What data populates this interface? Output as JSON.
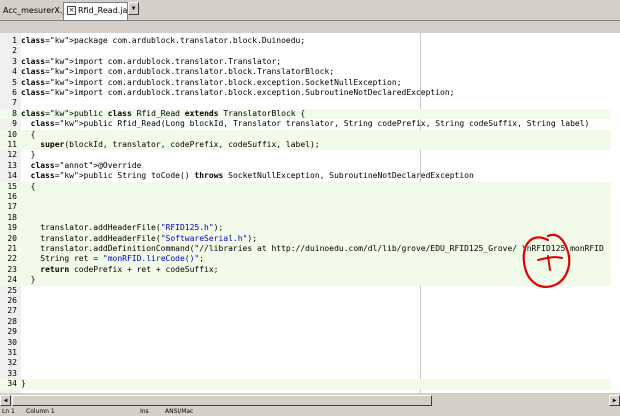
{
  "tabs": [
    {
      "label": "Acc_mesurerX.java",
      "active": false
    },
    {
      "label": "Rfid_Read.java",
      "active": true
    }
  ],
  "tab_dropdown_icon": "chevron-down-icon",
  "colors": {
    "highlight_line": "#f2fbe9",
    "string": "#0000cc",
    "annotation_scribble": "#e00000"
  },
  "lines": [
    {
      "n": "1",
      "text": "package com.ardublock.translator.block.Duinoedu;",
      "hl": false
    },
    {
      "n": "2",
      "text": "",
      "hl": false
    },
    {
      "n": "3",
      "text": "import com.ardublock.translator.Translator;",
      "hl": false
    },
    {
      "n": "4",
      "text": "import com.ardublock.translator.block.TranslatorBlock;",
      "hl": false
    },
    {
      "n": "5",
      "text": "import com.ardublock.translator.block.exception.SocketNullException;",
      "hl": false
    },
    {
      "n": "6",
      "text": "import com.ardublock.translator.block.exception.SubroutineNotDeclaredException;",
      "hl": false
    },
    {
      "n": "7",
      "text": "",
      "hl": false
    },
    {
      "n": "8",
      "text": "public class Rfid_Read extends TranslatorBlock {",
      "hl": true
    },
    {
      "n": "9",
      "text": "  public Rfid_Read(Long blockId, Translator translator, String codePrefix, String codeSuffix, String label)",
      "hl": false
    },
    {
      "n": "10",
      "text": "  {",
      "hl": true
    },
    {
      "n": "11",
      "text": "    super(blockId, translator, codePrefix, codeSuffix, label);",
      "hl": true
    },
    {
      "n": "12",
      "text": "  }",
      "hl": false
    },
    {
      "n": "13",
      "text": "  @Override",
      "hl": false
    },
    {
      "n": "14",
      "text": "  public String toCode() throws SocketNullException, SubroutineNotDeclaredException",
      "hl": false
    },
    {
      "n": "15",
      "text": "  {",
      "hl": true
    },
    {
      "n": "16",
      "text": "",
      "hl": true
    },
    {
      "n": "17",
      "text": "",
      "hl": true
    },
    {
      "n": "18",
      "text": "",
      "hl": true
    },
    {
      "n": "19",
      "text": "    translator.addHeaderFile(\"RFID125.h\");",
      "hl": true
    },
    {
      "n": "20",
      "text": "    translator.addHeaderFile(\"SoftwareSerial.h\");",
      "hl": true
    },
    {
      "n": "21",
      "text": "    translator.addDefinitionCommand(\"//libraries at http://duinoedu.com/dl/lib/grove/EDU_RFID125_Grove/ \\nRFID125 monRFID",
      "hl": true
    },
    {
      "n": "22",
      "text": "    String ret = \"monRFID.lireCode()\";",
      "hl": true
    },
    {
      "n": "23",
      "text": "    return codePrefix + ret + codeSuffix;",
      "hl": true
    },
    {
      "n": "24",
      "text": "  }",
      "hl": true
    },
    {
      "n": "25",
      "text": "",
      "hl": false
    },
    {
      "n": "26",
      "text": "",
      "hl": false
    },
    {
      "n": "27",
      "text": "",
      "hl": false
    },
    {
      "n": "28",
      "text": "",
      "hl": false
    },
    {
      "n": "29",
      "text": "",
      "hl": false
    },
    {
      "n": "30",
      "text": "",
      "hl": false
    },
    {
      "n": "31",
      "text": "",
      "hl": false
    },
    {
      "n": "32",
      "text": "",
      "hl": false
    },
    {
      "n": "33",
      "text": "",
      "hl": false
    },
    {
      "n": "34",
      "text": "}",
      "hl": true
    }
  ],
  "statusbar": {
    "line": "Ln 1",
    "column": "Column 1",
    "ins": "Ins",
    "encoding": "ANSI/Mac"
  }
}
